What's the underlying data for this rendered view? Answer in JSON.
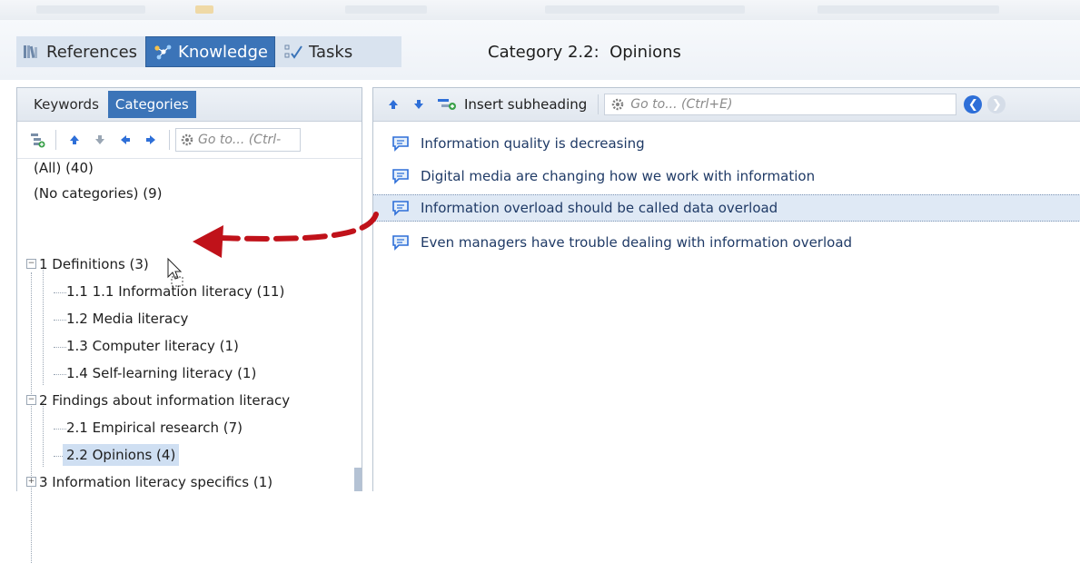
{
  "nav_tabs": [
    {
      "label": "References",
      "icon": "books-icon"
    },
    {
      "label": "Knowledge",
      "icon": "knowledge-network-icon"
    },
    {
      "label": "Tasks",
      "icon": "tasks-checklist-icon"
    }
  ],
  "breadcrumb_title": "Category 2.2:  Opinions",
  "left_pane": {
    "tabs": [
      "Keywords",
      "Categories"
    ],
    "active_tab": "Categories",
    "goto_placeholder": "Go to... (Ctrl-",
    "tree": [
      {
        "label": "(All) (40)"
      },
      {
        "label": "(No categories) (9)"
      },
      {
        "label": "1 Definitions (3)"
      },
      {
        "label": "1.1 1.1 Information literacy (11)"
      },
      {
        "label": "1.2 Media literacy"
      },
      {
        "label": "1.3 Computer literacy (1)"
      },
      {
        "label": "1.4 Self-learning literacy (1)"
      },
      {
        "label": "2 Findings about information literacy"
      },
      {
        "label": "2.1 Empirical research (7)"
      },
      {
        "label": "2.2 Opinions (4)"
      },
      {
        "label": "3 Information literacy specifics (1)"
      }
    ]
  },
  "right_pane": {
    "insert_label": "Insert subheading",
    "goto_placeholder": "Go to... (Ctrl+E)",
    "items": [
      {
        "label": "Information quality is decreasing"
      },
      {
        "label": "Digital media are changing how we work with information"
      },
      {
        "label": "Information overload should be called data overload"
      },
      {
        "label": "Even managers have trouble dealing with information overload"
      }
    ]
  },
  "colors": {
    "accent": "#3b74b8",
    "selection": "#cfdff2",
    "drag_arrow": "#c0121a",
    "nav_back": "#2e6fd8"
  }
}
